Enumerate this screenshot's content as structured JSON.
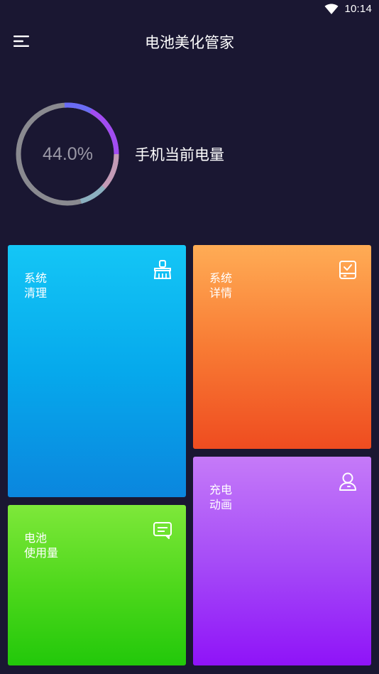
{
  "status_bar": {
    "time": "10:14",
    "wifi_icon": "wifi-icon"
  },
  "header": {
    "menu_icon": "menu-icon",
    "title": "电池美化管家"
  },
  "battery": {
    "percent_text": "44.0%",
    "percent_value": 44.0,
    "label": "手机当前电量",
    "colors": {
      "track": "#8a8a90",
      "segment_blue": "#6a6cf5",
      "segment_purple": "#a24cf2",
      "segment_pink": "#c39ab6",
      "segment_teal": "#8bb0c0"
    }
  },
  "tiles": [
    {
      "id": "clean",
      "line1": "系统",
      "line2": "清理",
      "icon": "broom-icon"
    },
    {
      "id": "details",
      "line1": "系统",
      "line2": "详情",
      "icon": "checklist-icon"
    },
    {
      "id": "usage",
      "line1": "电池",
      "line2": "使用量",
      "icon": "message-icon"
    },
    {
      "id": "charge",
      "line1": "充电",
      "line2": "动画",
      "icon": "user-icon"
    }
  ],
  "colors": {
    "background": "#1a1732",
    "tile_clean": "#0a9fe8",
    "tile_details": "#f6752f",
    "tile_usage": "#43d314",
    "tile_charge": "#a048f7"
  }
}
